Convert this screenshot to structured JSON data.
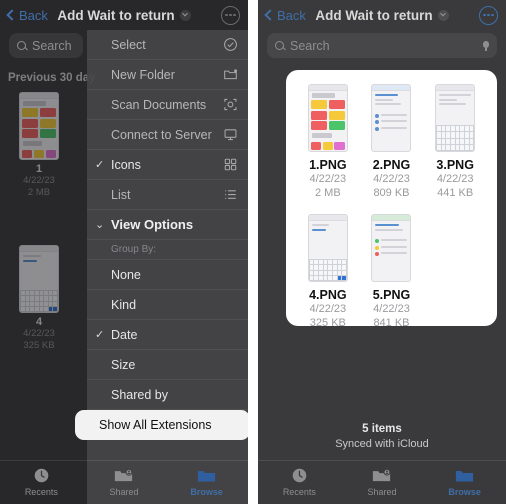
{
  "left_panel": {
    "nav": {
      "back_label": "Back",
      "title": "Add Wait to return",
      "title_chevron_icon": "chevron-down-icon",
      "more_icon": "more-ellipsis-icon"
    },
    "search": {
      "placeholder": "Search",
      "icon": "search-icon"
    },
    "section_header": "Previous 30 day",
    "background_files": [
      {
        "name": "1",
        "date": "4/22/23",
        "size": "2 MB"
      },
      {
        "name": "4",
        "date": "4/22/23",
        "size": "325 KB"
      }
    ],
    "context_menu": {
      "items": [
        {
          "label": "Select",
          "icon": "check-circle-icon",
          "checked": false,
          "kind": "normal"
        },
        {
          "label": "New Folder",
          "icon": "new-folder-icon",
          "checked": false,
          "kind": "normal"
        },
        {
          "label": "Scan Documents",
          "icon": "scan-document-icon",
          "checked": false,
          "kind": "normal"
        },
        {
          "label": "Connect to Server",
          "icon": "server-icon",
          "checked": false,
          "kind": "normal"
        },
        {
          "label": "Icons",
          "icon": "grid-icon",
          "checked": true,
          "kind": "normal"
        },
        {
          "label": "List",
          "icon": "list-icon",
          "checked": false,
          "kind": "normal"
        },
        {
          "label": "View Options",
          "icon": "",
          "checked": false,
          "kind": "header"
        },
        {
          "label": "Group By:",
          "icon": "",
          "checked": false,
          "kind": "group"
        },
        {
          "label": "None",
          "icon": "",
          "checked": false,
          "kind": "normal"
        },
        {
          "label": "Kind",
          "icon": "",
          "checked": false,
          "kind": "normal"
        },
        {
          "label": "Date",
          "icon": "",
          "checked": true,
          "kind": "normal"
        },
        {
          "label": "Size",
          "icon": "",
          "checked": false,
          "kind": "normal"
        },
        {
          "label": "Shared by",
          "icon": "",
          "checked": false,
          "kind": "normal"
        },
        {
          "label": "Show All Extensions",
          "icon": "",
          "checked": false,
          "kind": "highlight"
        }
      ]
    },
    "tabs": [
      {
        "label": "Recents",
        "icon": "clock-icon",
        "active": false
      },
      {
        "label": "Shared",
        "icon": "shared-folder-icon",
        "active": false
      },
      {
        "label": "Browse",
        "icon": "folder-icon",
        "active": true
      }
    ]
  },
  "right_panel": {
    "nav": {
      "back_label": "Back",
      "title": "Add Wait to return",
      "title_chevron_icon": "chevron-down-icon",
      "more_icon": "more-ellipsis-icon"
    },
    "search": {
      "placeholder": "Search",
      "icon": "search-icon",
      "mic_icon": "microphone-icon"
    },
    "files": [
      {
        "name": "1.PNG",
        "date": "4/22/23",
        "size": "2 MB"
      },
      {
        "name": "2.PNG",
        "date": "4/22/23",
        "size": "809 KB"
      },
      {
        "name": "3.PNG",
        "date": "4/22/23",
        "size": "441 KB"
      },
      {
        "name": "4.PNG",
        "date": "4/22/23",
        "size": "325 KB"
      },
      {
        "name": "5.PNG",
        "date": "4/22/23",
        "size": "841 KB"
      }
    ],
    "status": {
      "items_count": "5 items",
      "sync": "Synced with iCloud"
    },
    "tabs": [
      {
        "label": "Recents",
        "icon": "clock-icon",
        "active": false
      },
      {
        "label": "Shared",
        "icon": "shared-folder-icon",
        "active": false
      },
      {
        "label": "Browse",
        "icon": "folder-icon",
        "active": true
      }
    ]
  },
  "colors": {
    "accent": "#3f6fa8",
    "panel_bg": "#3a3a3c",
    "menu_bg": "#464648",
    "card_bg": "#ffffff",
    "highlight_bg": "#f2f2f2"
  }
}
